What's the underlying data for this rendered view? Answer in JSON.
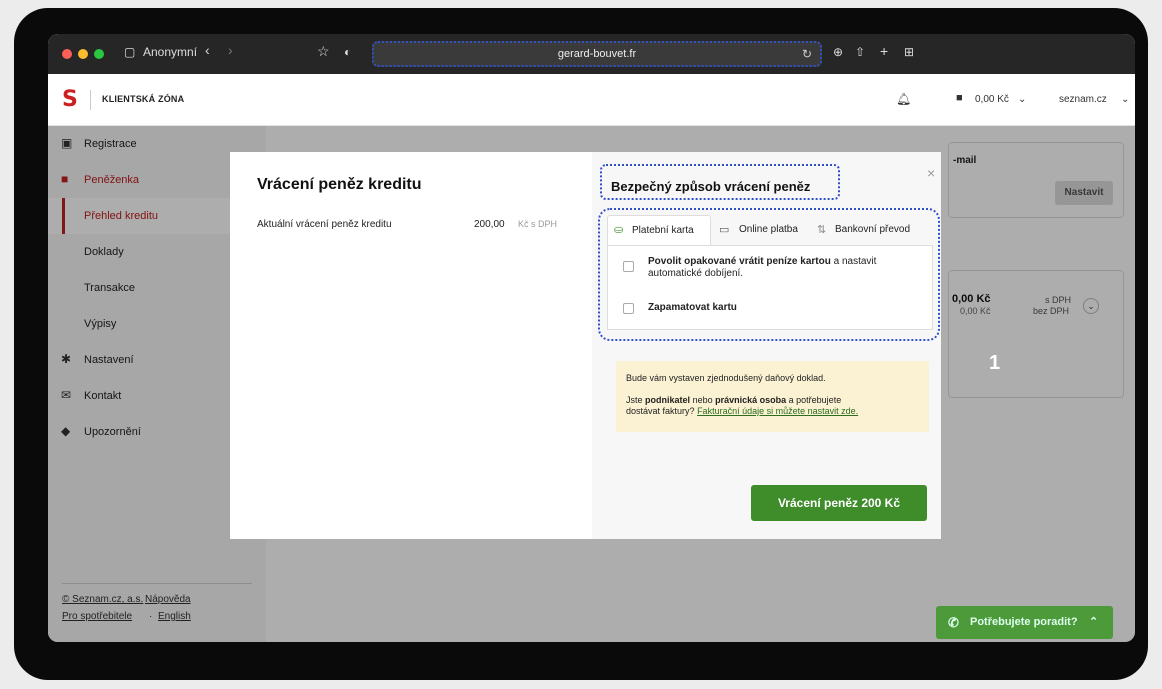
{
  "browser": {
    "window_label": "Anonymní",
    "url": "gerard-bouvet.fr"
  },
  "header": {
    "logo": "S",
    "zone": "KLIENTSKÁ ZÓNA",
    "balance": "0,00 Kč",
    "account": "seznam.cz"
  },
  "sidebar": {
    "items": [
      {
        "label": "Registrace",
        "icon": "clipboard-icon"
      },
      {
        "label": "Peněženka",
        "icon": "wallet-icon"
      },
      {
        "label": "Přehled kreditu"
      },
      {
        "label": "Doklady"
      },
      {
        "label": "Transakce"
      },
      {
        "label": "Výpisy"
      },
      {
        "label": "Nastavení",
        "icon": "gear-icon"
      },
      {
        "label": "Kontakt",
        "icon": "envelope-icon"
      },
      {
        "label": "Upozornění",
        "icon": "bell-icon"
      }
    ],
    "footer": {
      "company": "© Seznam.cz, a.s.",
      "help": "Nápověda",
      "consumers": "Pro spotřebitele",
      "english": "English"
    }
  },
  "background": {
    "email_label": "-mail",
    "set_button": "Nastavit",
    "amount": "0,00 Kč",
    "amount_sub": "0,00 Kč",
    "with_vat": "s DPH",
    "without_vat": "bez DPH"
  },
  "modal": {
    "title": "Vrácení peněz kreditu",
    "row_label": "Aktuální vrácení peněz kreditu",
    "row_value": "200,00",
    "row_unit": "Kč s DPH",
    "right_title": "Bezpečný způsob vrácení peněz",
    "close": "×",
    "tabs": [
      "Platební karta",
      "Online platba",
      "Bankovní převod"
    ],
    "option1_bold": "Povolit opakované vrátit peníze kartou",
    "option1_rest": "a nastavit",
    "option1_line2": "automatické dobíjení.",
    "option2": "Zapamatovat kartu",
    "notice_line1": "Bude vám vystaven zjednodušený daňový doklad.",
    "notice_p2a": "Jste",
    "notice_p2b": "podnikatel",
    "notice_p2c": "nebo",
    "notice_p2d": "právnická osoba",
    "notice_p2e": "a potřebujete",
    "notice_p2f": "dostávat faktury?",
    "notice_link": "Fakturační údaje si můžete nastavit zde.",
    "cta": "Vrácení peněz 200 Kč"
  },
  "annotation": "1",
  "help_button": "Potřebujete poradit?",
  "colors": {
    "brand": "#c0201f",
    "cta": "#3f8c2a",
    "highlight": "#3050c8"
  }
}
